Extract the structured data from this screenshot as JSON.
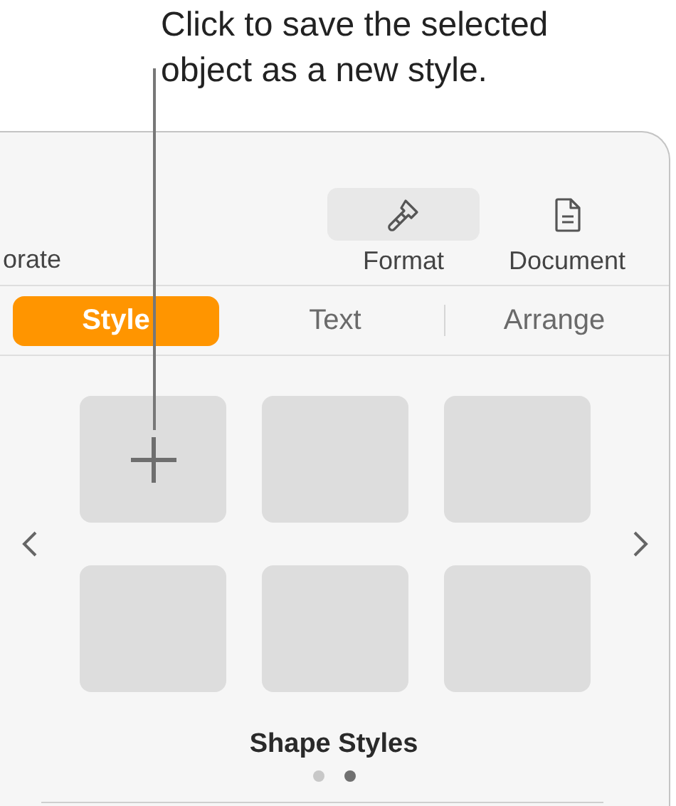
{
  "callout": {
    "text": "Click to save the selected object as a new style."
  },
  "toolbar": {
    "cut_label": "orate",
    "buttons": [
      {
        "label": "Format",
        "kind": "brush",
        "selected": true
      },
      {
        "label": "Document",
        "kind": "document",
        "selected": false
      }
    ]
  },
  "tabs": [
    {
      "label": "Style",
      "selected": true
    },
    {
      "label": "Text",
      "selected": false
    },
    {
      "label": "Arrange",
      "selected": false
    }
  ],
  "styles": {
    "tiles": [
      {
        "kind": "add"
      },
      {
        "kind": "empty"
      },
      {
        "kind": "empty"
      },
      {
        "kind": "empty"
      },
      {
        "kind": "empty"
      },
      {
        "kind": "empty"
      }
    ],
    "title": "Shape Styles",
    "pages": [
      {
        "selected": false
      },
      {
        "selected": true
      }
    ]
  }
}
